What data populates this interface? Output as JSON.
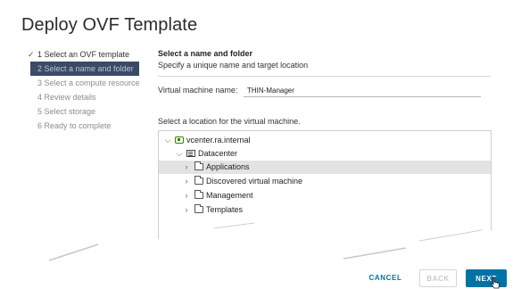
{
  "dialog": {
    "title": "Deploy OVF Template"
  },
  "steps": [
    {
      "label": "1 Select an OVF template",
      "state": "done"
    },
    {
      "label": "2 Select a name and folder",
      "state": "active"
    },
    {
      "label": "3 Select a compute resource",
      "state": "pending"
    },
    {
      "label": "4 Review details",
      "state": "pending"
    },
    {
      "label": "5 Select storage",
      "state": "pending"
    },
    {
      "label": "6 Ready to complete",
      "state": "pending"
    }
  ],
  "main": {
    "heading": "Select a name and folder",
    "subheading": "Specify a unique name and target location",
    "vm_name_label": "Virtual machine name:",
    "vm_name_value": "THIN-Manager",
    "location_label": "Select a location for the virtual machine."
  },
  "tree": [
    {
      "label": "vcenter.ra.internal",
      "icon": "vcenter-icon",
      "expanded": true
    },
    {
      "label": "Datacenter",
      "icon": "datacenter-icon",
      "expanded": true
    },
    {
      "label": "Applications",
      "icon": "folder-icon",
      "expanded": false,
      "selected": true
    },
    {
      "label": "Discovered virtual machine",
      "icon": "folder-icon",
      "expanded": false
    },
    {
      "label": "Management",
      "icon": "folder-icon",
      "expanded": false
    },
    {
      "label": "Templates",
      "icon": "folder-icon",
      "expanded": false
    }
  ],
  "footer": {
    "cancel": "CANCEL",
    "back": "BACK",
    "next": "NEXT"
  },
  "colors": {
    "accent": "#0072a3",
    "active_step_bg": "#3b4a66",
    "check": "#2f8400",
    "selected_row": "#e3e3e3"
  }
}
